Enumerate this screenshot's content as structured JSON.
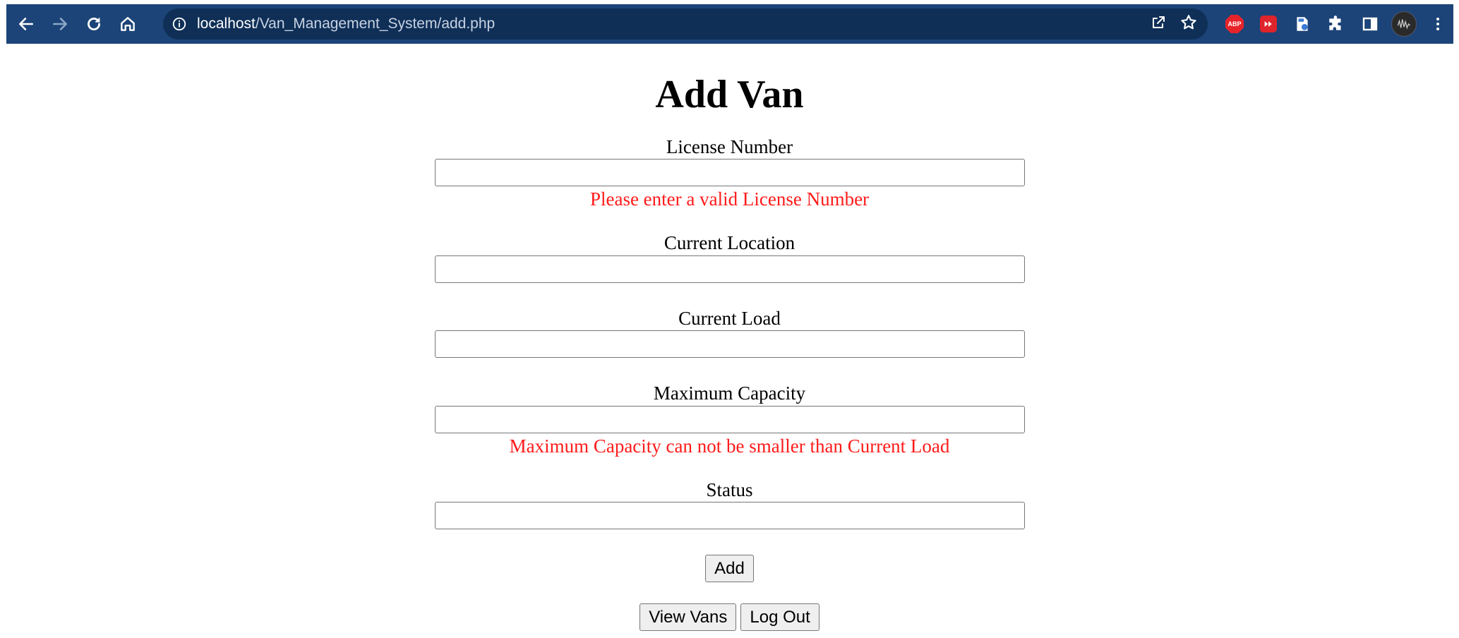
{
  "browser": {
    "url_host": "localhost",
    "url_path": "/Van_Management_System/add.php"
  },
  "page": {
    "title": "Add Van"
  },
  "form": {
    "license": {
      "label": "License Number",
      "value": "",
      "error": "Please enter a valid License Number"
    },
    "location": {
      "label": "Current Location",
      "value": ""
    },
    "load": {
      "label": "Current Load",
      "value": ""
    },
    "capacity": {
      "label": "Maximum Capacity",
      "value": "",
      "error": "Maximum Capacity can not be smaller than Current Load"
    },
    "status": {
      "label": "Status",
      "value": ""
    },
    "submit_label": "Add"
  },
  "nav": {
    "view_vans_label": "View Vans",
    "logout_label": "Log Out"
  },
  "extensions": {
    "abp_text": "ABP"
  },
  "colors": {
    "toolbar": "#1c4478",
    "error": "#ff1a1a"
  }
}
